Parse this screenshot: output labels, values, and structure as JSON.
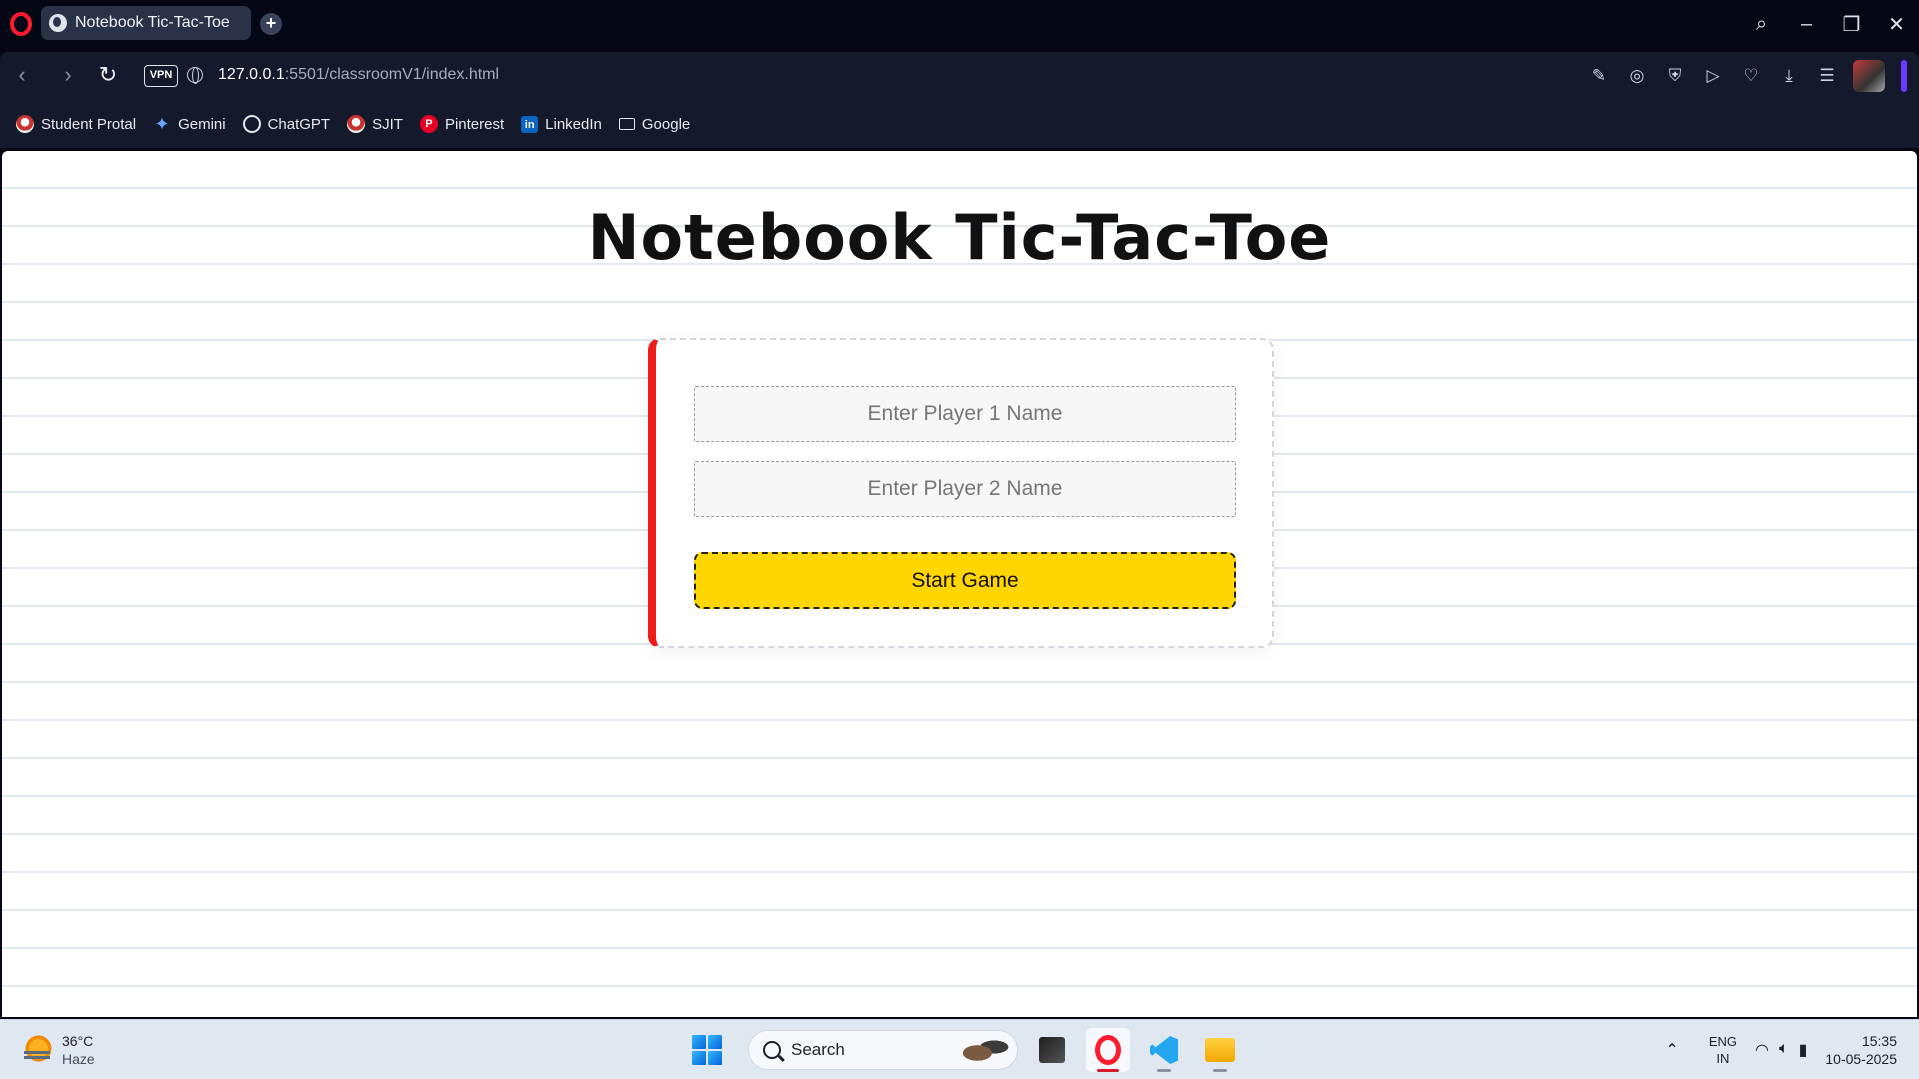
{
  "browser": {
    "tab_title": "Notebook Tic-Tac-Toe",
    "new_tab_label": "+",
    "vpn_label": "VPN",
    "url_host": "127.0.0.1",
    "url_path": ":5501/classroomV1/index.html"
  },
  "bookmarks": [
    {
      "label": "Student Protal",
      "icon": "portal-icon"
    },
    {
      "label": "Gemini",
      "icon": "gemini-icon"
    },
    {
      "label": "ChatGPT",
      "icon": "chatgpt-icon"
    },
    {
      "label": "SJIT",
      "icon": "sjit-icon"
    },
    {
      "label": "Pinterest",
      "icon": "pinterest-icon"
    },
    {
      "label": "LinkedIn",
      "icon": "linkedin-icon"
    },
    {
      "label": "Google",
      "icon": "folder-icon"
    }
  ],
  "page": {
    "title": "Notebook Tic-Tac-Toe",
    "player1_placeholder": "Enter Player 1 Name",
    "player2_placeholder": "Enter Player 2 Name",
    "start_label": "Start Game",
    "accent_color": "#ee1b1b",
    "button_color": "#ffd600"
  },
  "taskbar": {
    "temperature": "36°C",
    "condition": "Haze",
    "search_label": "Search",
    "lang_primary": "ENG",
    "lang_region": "IN",
    "time": "15:35",
    "date": "10-05-2025"
  }
}
